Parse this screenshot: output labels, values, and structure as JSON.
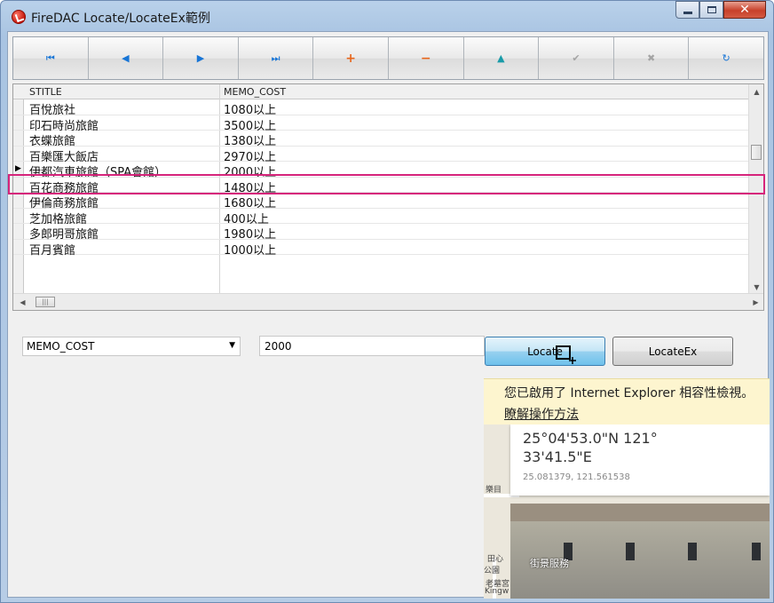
{
  "window": {
    "title": "FireDAC Locate/LocateEx範例",
    "controls": [
      "minimize",
      "maximize",
      "close"
    ]
  },
  "navigator": {
    "buttons": [
      {
        "name": "first",
        "icon": "first-record-icon",
        "glyph": "⏮",
        "color": "#1875d6"
      },
      {
        "name": "prior",
        "icon": "prior-record-icon",
        "glyph": "◀",
        "color": "#1875d6"
      },
      {
        "name": "next",
        "icon": "next-record-icon",
        "glyph": "▶",
        "color": "#1875d6"
      },
      {
        "name": "last",
        "icon": "last-record-icon",
        "glyph": "⏭",
        "color": "#1875d6"
      },
      {
        "name": "insert",
        "icon": "plus-icon",
        "glyph": "+",
        "color": "#e8661c"
      },
      {
        "name": "delete",
        "icon": "minus-icon",
        "glyph": "−",
        "color": "#e8661c"
      },
      {
        "name": "edit",
        "icon": "edit-up-icon",
        "glyph": "▲",
        "color": "#199ba8"
      },
      {
        "name": "post",
        "icon": "check-icon",
        "glyph": "✔",
        "color": "#a4a4a4"
      },
      {
        "name": "cancel",
        "icon": "cancel-icon",
        "glyph": "✖",
        "color": "#a4a4a4"
      },
      {
        "name": "refresh",
        "icon": "refresh-icon",
        "glyph": "↻",
        "color": "#1875d6"
      }
    ]
  },
  "grid": {
    "columns": [
      "STITLE",
      "MEMO_COST"
    ],
    "selected_index": 4,
    "rows": [
      {
        "stitle": "百悅旅社",
        "memo_cost": "1080以上"
      },
      {
        "stitle": "印石時尚旅館",
        "memo_cost": "3500以上"
      },
      {
        "stitle": "衣蝶旅館",
        "memo_cost": "1380以上"
      },
      {
        "stitle": "百樂匯大飯店",
        "memo_cost": "2970以上"
      },
      {
        "stitle": "伊都汽車旅館（SPA會館）",
        "memo_cost": "2000以上"
      },
      {
        "stitle": "百花商務旅館",
        "memo_cost": "1480以上"
      },
      {
        "stitle": "伊倫商務旅館",
        "memo_cost": "1680以上"
      },
      {
        "stitle": "芝加格旅館",
        "memo_cost": "400以上"
      },
      {
        "stitle": "多郎明哥旅館",
        "memo_cost": "1980以上"
      },
      {
        "stitle": "百月賓館",
        "memo_cost": "1000以上"
      }
    ]
  },
  "search": {
    "field_selected": "MEMO_COST",
    "value": "2000",
    "locate_label": "Locate",
    "locateex_label": "LocateEx"
  },
  "ie_notice": {
    "line1": "您已啟用了 Internet Explorer 相容性檢視。",
    "link": "瞭解操作方法"
  },
  "map": {
    "coords_dms": "25°04'53.0\"N 121° 33'41.5\"E",
    "coords_decimal": "25.081379, 121.561538",
    "street_view_label": "街景服務",
    "labels": [
      "樂目",
      "田心",
      "公園",
      "老墓宮",
      "Kingw"
    ]
  }
}
